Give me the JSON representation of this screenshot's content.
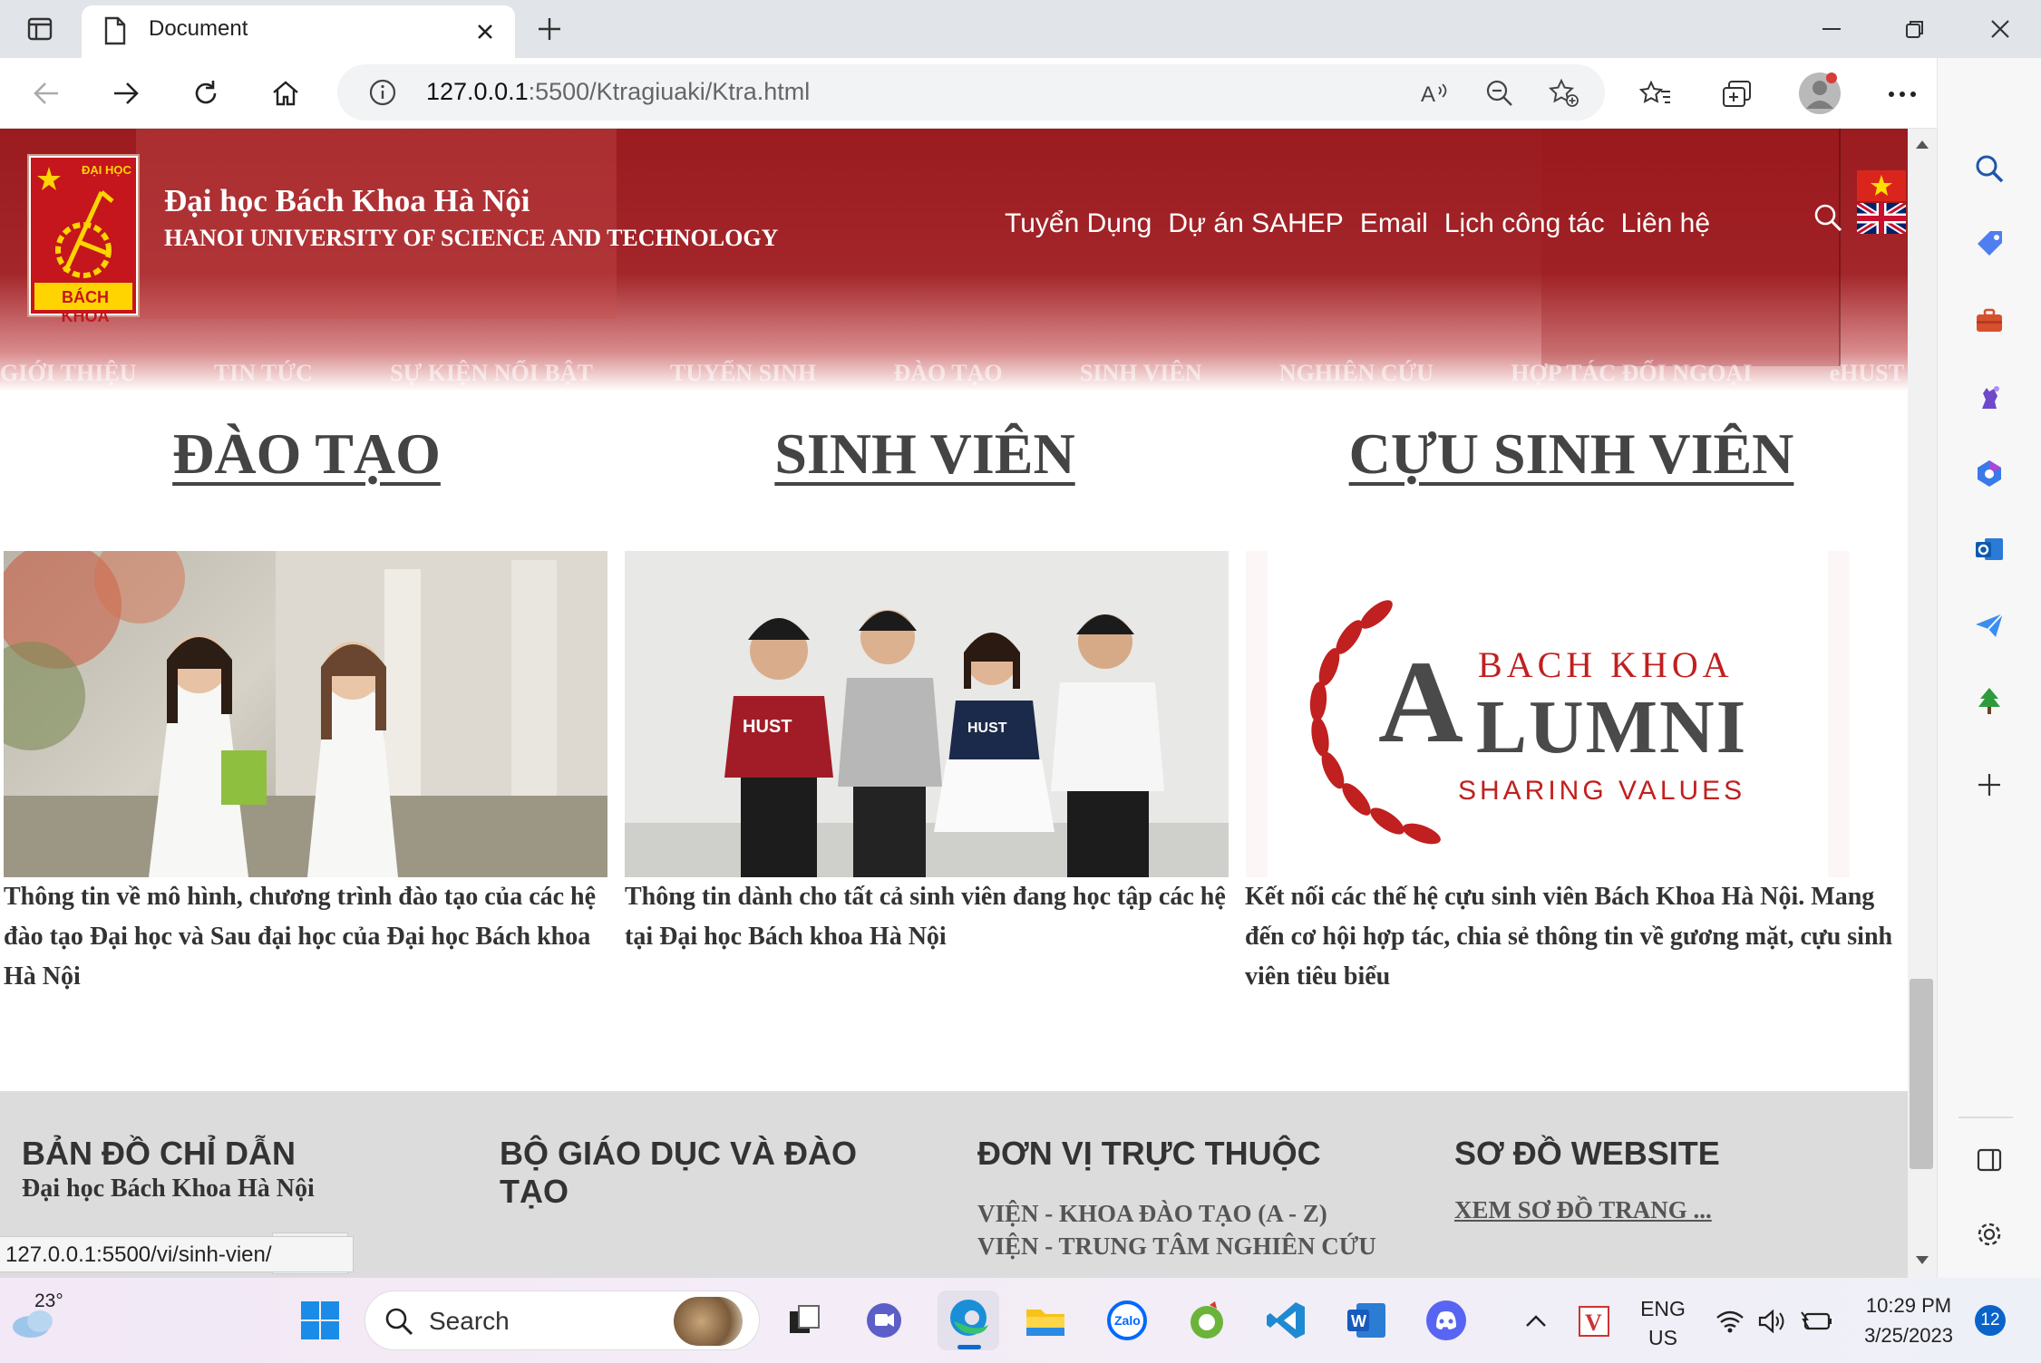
{
  "browser": {
    "tab_title": "Document",
    "url_host": "127.0.0.1",
    "url_rest": ":5500/Ktragiuaki/Ktra.html",
    "status_url": "127.0.0.1:5500/vi/sinh-vien/"
  },
  "header": {
    "school_vi": "Đại học Bách Khoa Hà Nội",
    "school_en": "HANOI UNIVERSITY OF SCIENCE AND TECHNOLOGY",
    "logo_top": "ĐẠI HỌC",
    "logo_bottom": "BÁCH KHOA",
    "top_nav": [
      "Tuyển Dụng",
      "Dự án SAHEP",
      "Email",
      "Lịch công tác",
      "Liên hệ"
    ],
    "main_menu": [
      "GIỚI THIỆU",
      "TIN TỨC",
      "SỰ KIỆN NỔI BẬT",
      "TUYỂN SINH",
      "ĐÀO TẠO",
      "SINH VIÊN",
      "NGHIÊN CỨU",
      "HỢP TÁC ĐỐI NGOẠI",
      "eHUST"
    ]
  },
  "sections": [
    {
      "title": "ĐÀO TẠO",
      "text": "Thông tin về mô hình, chương trình đào tạo của các hệ đào tạo Đại học và Sau đại học của Đại học Bách khoa Hà Nội"
    },
    {
      "title": "SINH VIÊN",
      "text": "Thông tin dành cho tất cả sinh viên đang học tập các hệ tại Đại học Bách khoa Hà Nội"
    },
    {
      "title": "CỰU SINH VIÊN",
      "text": "Kết nối các thế hệ cựu sinh viên Bách Khoa Hà Nội. Mang đến cơ hội hợp tác, chia sẻ thông tin về gương mặt, cựu sinh viên tiêu biểu"
    }
  ],
  "alumni_logo": {
    "line1": "BACH KHOA",
    "line2a": "A",
    "line2b": "LUMNI",
    "line3": "SHARING VALUES"
  },
  "shirt_text": "HUST",
  "footer": {
    "col1_title": "BẢN ĐỒ CHỈ DẪN",
    "col1_sub": "Đại học Bách Khoa Hà Nội",
    "col2_title": "BỘ GIÁO DỤC VÀ ĐÀO TẠO",
    "col3_title": "ĐƠN VỊ TRỰC THUỘC",
    "col3_links": [
      "VIỆN - KHOA ĐÀO TẠO (A - Z)",
      "VIỆN - TRUNG TÂM NGHIÊN CỨU"
    ],
    "col4_title": "SƠ ĐỒ WEBSITE",
    "col4_link": "XEM SƠ ĐỒ TRANG ..."
  },
  "taskbar": {
    "weather_temp": "23°",
    "search_placeholder": "Search",
    "lang_top": "ENG",
    "lang_bottom": "US",
    "time": "10:29 PM",
    "date": "3/25/2023",
    "notif_count": "12"
  },
  "colors": {
    "brand_red": "#9b1b1f",
    "footer_bg": "#dcdcdc",
    "edge_blue": "#0c59c7"
  }
}
